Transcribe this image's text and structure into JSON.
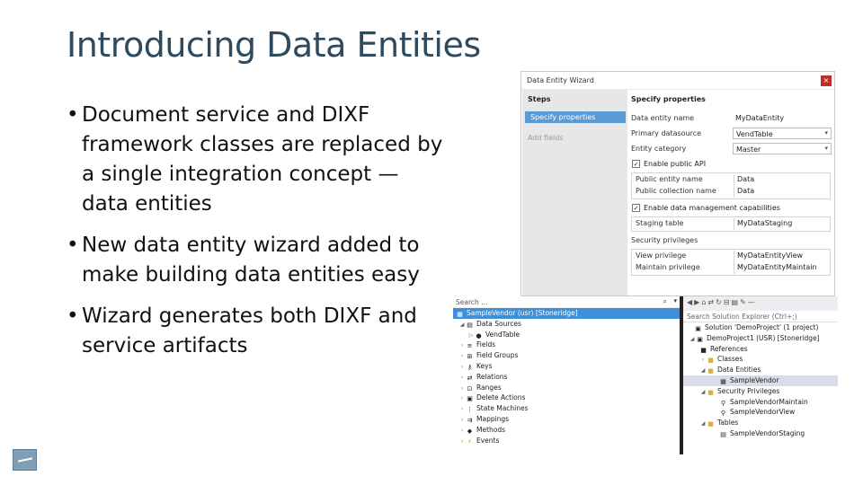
{
  "slide": {
    "title": "Introducing Data Entities",
    "bullets": [
      "Document service and DIXF framework classes are replaced by a single integration concept —data entities",
      "New data entity wizard added to make building data entities easy",
      "Wizard generates both DIXF and service artifacts"
    ]
  },
  "wizard": {
    "title": "Data Entity Wizard",
    "close_icon": "×",
    "steps_header": "Steps",
    "steps": [
      "Specify properties",
      "Add fields"
    ],
    "props_header": "Specify properties",
    "fields": [
      {
        "label": "Data entity name",
        "value": "MyDataEntity"
      },
      {
        "label": "Primary datasource",
        "value": "VendTable"
      },
      {
        "label": "Entity category",
        "value": "Master"
      }
    ],
    "public_api": {
      "label": "Enable public API",
      "checked": true
    },
    "public_fields": [
      {
        "label": "Public entity name",
        "value": "Data"
      },
      {
        "label": "Public collection name",
        "value": "Data"
      }
    ],
    "data_mgmt": {
      "label": "Enable data management capabilities",
      "checked": true
    },
    "staging": {
      "label": "Staging table",
      "value": "MyDataStaging"
    },
    "security_label": "Security privileges",
    "privileges": [
      {
        "label": "View privilege",
        "value": "MyDataEntityView"
      },
      {
        "label": "Maintain privilege",
        "value": "MyDataEntityMaintain"
      }
    ]
  },
  "app_explorer": {
    "search_placeholder": "Search ...",
    "items": [
      {
        "label": "SampleVendor (usr) [Stoneridge]",
        "icon": "entity-icon"
      },
      {
        "label": "Data Sources",
        "icon": "datasources-icon"
      },
      {
        "label": "VendTable",
        "icon": "table-icon"
      },
      {
        "label": "Fields",
        "icon": "fields-icon"
      },
      {
        "label": "Field Groups",
        "icon": "fieldgroups-icon"
      },
      {
        "label": "Keys",
        "icon": "keys-icon"
      },
      {
        "label": "Relations",
        "icon": "relations-icon"
      },
      {
        "label": "Ranges",
        "icon": "ranges-icon"
      },
      {
        "label": "Delete Actions",
        "icon": "delete-actions-icon"
      },
      {
        "label": "State Machines",
        "icon": "state-machines-icon"
      },
      {
        "label": "Mappings",
        "icon": "mappings-icon"
      },
      {
        "label": "Methods",
        "icon": "methods-icon"
      },
      {
        "label": "Events",
        "icon": "events-icon"
      }
    ]
  },
  "solution_explorer": {
    "search_placeholder": "Search Solution Explorer (Ctrl+;)",
    "items": [
      {
        "label": "Solution 'DemoProject' (1 project)"
      },
      {
        "label": "DemoProject1 (USR) [Stoneridge]"
      },
      {
        "label": "References"
      },
      {
        "label": "Classes"
      },
      {
        "label": "Data Entities"
      },
      {
        "label": "SampleVendor"
      },
      {
        "label": "Security Privileges"
      },
      {
        "label": "SampleVendorMaintain"
      },
      {
        "label": "SampleVendorView"
      },
      {
        "label": "Tables"
      },
      {
        "label": "SampleVendorStaging"
      }
    ]
  },
  "colors": {
    "title": "#2e4a5e",
    "selection": "#3f8fd8",
    "wizard_step_active": "#5b9bd5",
    "close": "#c42b2b"
  }
}
